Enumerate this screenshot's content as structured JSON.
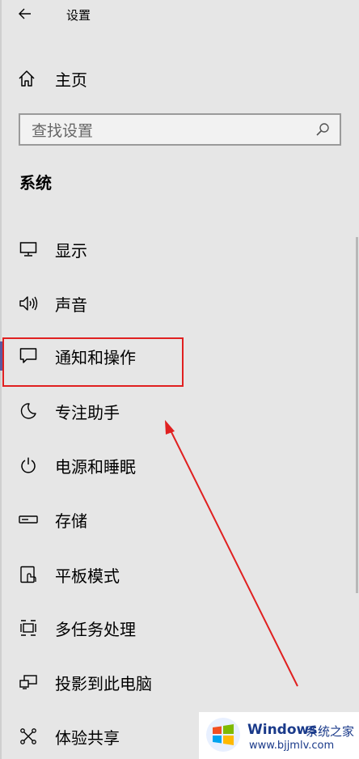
{
  "window": {
    "title": "设置",
    "back_icon": "back-arrow-icon"
  },
  "home": {
    "label": "主页",
    "icon": "home-icon"
  },
  "search": {
    "placeholder": "查找设置",
    "icon": "search-icon"
  },
  "section": {
    "title": "系统"
  },
  "nav": {
    "items": [
      {
        "label": "显示",
        "icon": "monitor-icon"
      },
      {
        "label": "声音",
        "icon": "speaker-icon"
      },
      {
        "label": "通知和操作",
        "icon": "notification-icon",
        "selected": true
      },
      {
        "label": "专注助手",
        "icon": "moon-icon"
      },
      {
        "label": "电源和睡眠",
        "icon": "power-icon"
      },
      {
        "label": "存储",
        "icon": "storage-icon"
      },
      {
        "label": "平板模式",
        "icon": "tablet-icon"
      },
      {
        "label": "多任务处理",
        "icon": "multitask-icon"
      },
      {
        "label": "投影到此电脑",
        "icon": "project-icon"
      },
      {
        "label": "体验共享",
        "icon": "share-icon"
      }
    ]
  },
  "annotation": {
    "box_color": "#e02020",
    "arrow_color": "#e02020"
  },
  "watermark": {
    "brand": "Windows",
    "subtitle": "系统之家",
    "url": "www.bjjmlv.com"
  }
}
